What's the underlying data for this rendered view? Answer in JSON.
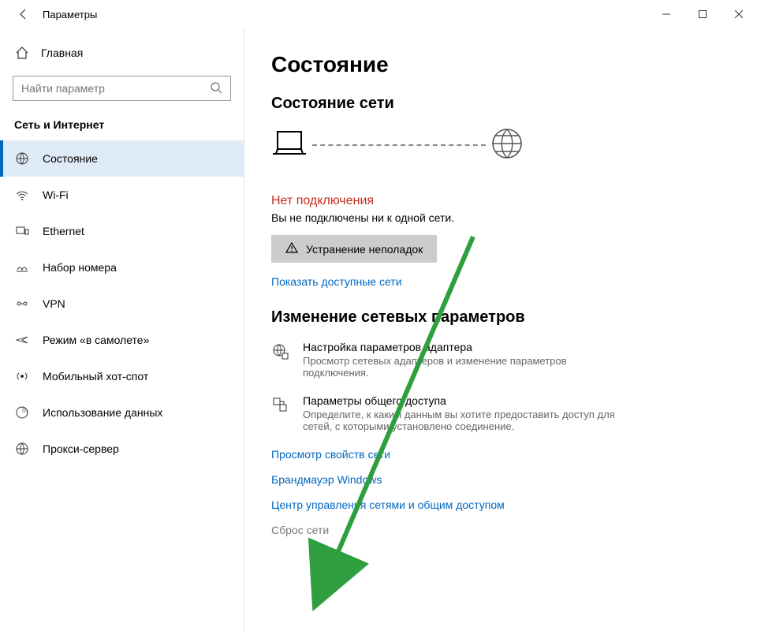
{
  "titlebar": {
    "title": "Параметры"
  },
  "sidebar": {
    "home": "Главная",
    "search_placeholder": "Найти параметр",
    "section": "Сеть и Интернет",
    "items": [
      {
        "label": "Состояние",
        "active": true
      },
      {
        "label": "Wi-Fi"
      },
      {
        "label": "Ethernet"
      },
      {
        "label": "Набор номера"
      },
      {
        "label": "VPN"
      },
      {
        "label": "Режим «в самолете»"
      },
      {
        "label": "Мобильный хот-спот"
      },
      {
        "label": "Использование данных"
      },
      {
        "label": "Прокси-сервер"
      }
    ]
  },
  "main": {
    "page_title": "Состояние",
    "network_status_heading": "Состояние сети",
    "error_title": "Нет подключения",
    "error_msg": "Вы не подключены ни к одной сети.",
    "troubleshoot": "Устранение неполадок",
    "show_networks": "Показать доступные сети",
    "change_heading": "Изменение сетевых параметров",
    "adapter": {
      "title": "Настройка параметров адаптера",
      "desc": "Просмотр сетевых адаптеров и изменение параметров подключения."
    },
    "sharing": {
      "title": "Параметры общего доступа",
      "desc": "Определите, к каким данным вы хотите предоставить доступ для сетей, с которыми установлено соединение."
    },
    "links": {
      "view_props": "Просмотр свойств сети",
      "firewall": "Брандмауэр Windows",
      "sharing_center": "Центр управления сетями и общим доступом"
    },
    "reset": "Сброс сети"
  }
}
